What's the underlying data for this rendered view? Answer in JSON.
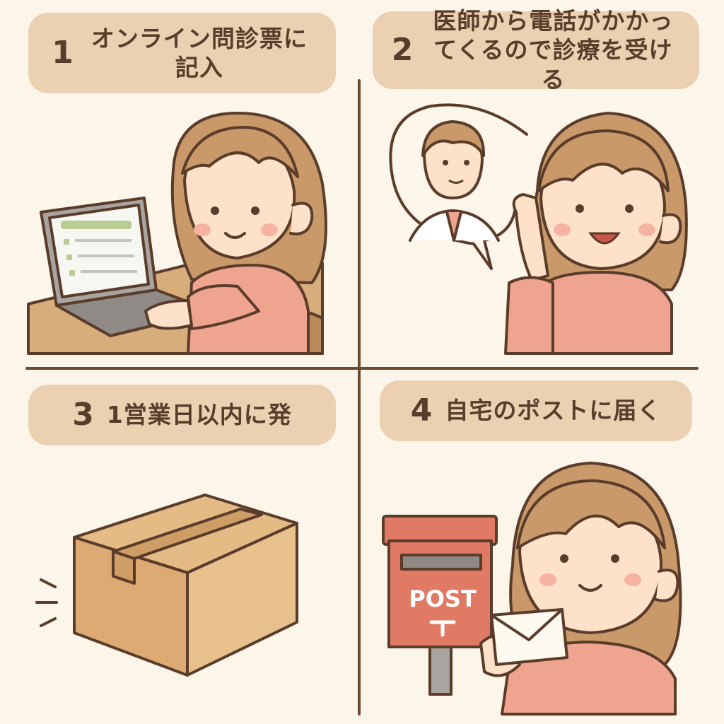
{
  "steps": [
    {
      "number": "1",
      "text": "オンライン問診票に記入"
    },
    {
      "number": "2",
      "text": "医師から電話がかかってくるので診療を受ける"
    },
    {
      "number": "3",
      "text": "1営業日以内に発"
    },
    {
      "number": "4",
      "text": "自宅のポストに届く"
    }
  ],
  "illustrations": {
    "step1": {
      "icon": "woman-laptop-illustration"
    },
    "step2": {
      "icon": "woman-phone-call-with-doctor-illustration"
    },
    "step3": {
      "icon": "cardboard-box-illustration"
    },
    "step4": {
      "icon": "woman-postbox-envelope-illustration",
      "postbox_text": "POST"
    }
  },
  "colors": {
    "background": "#fbf5ea",
    "label_bg": "#ebd1b2",
    "ink": "#5a3c2a",
    "hair": "#c9996a",
    "skin": "#fde1c8",
    "shirt": "#efa48f",
    "postbox": "#e07a64",
    "box": "#dcaa72"
  }
}
